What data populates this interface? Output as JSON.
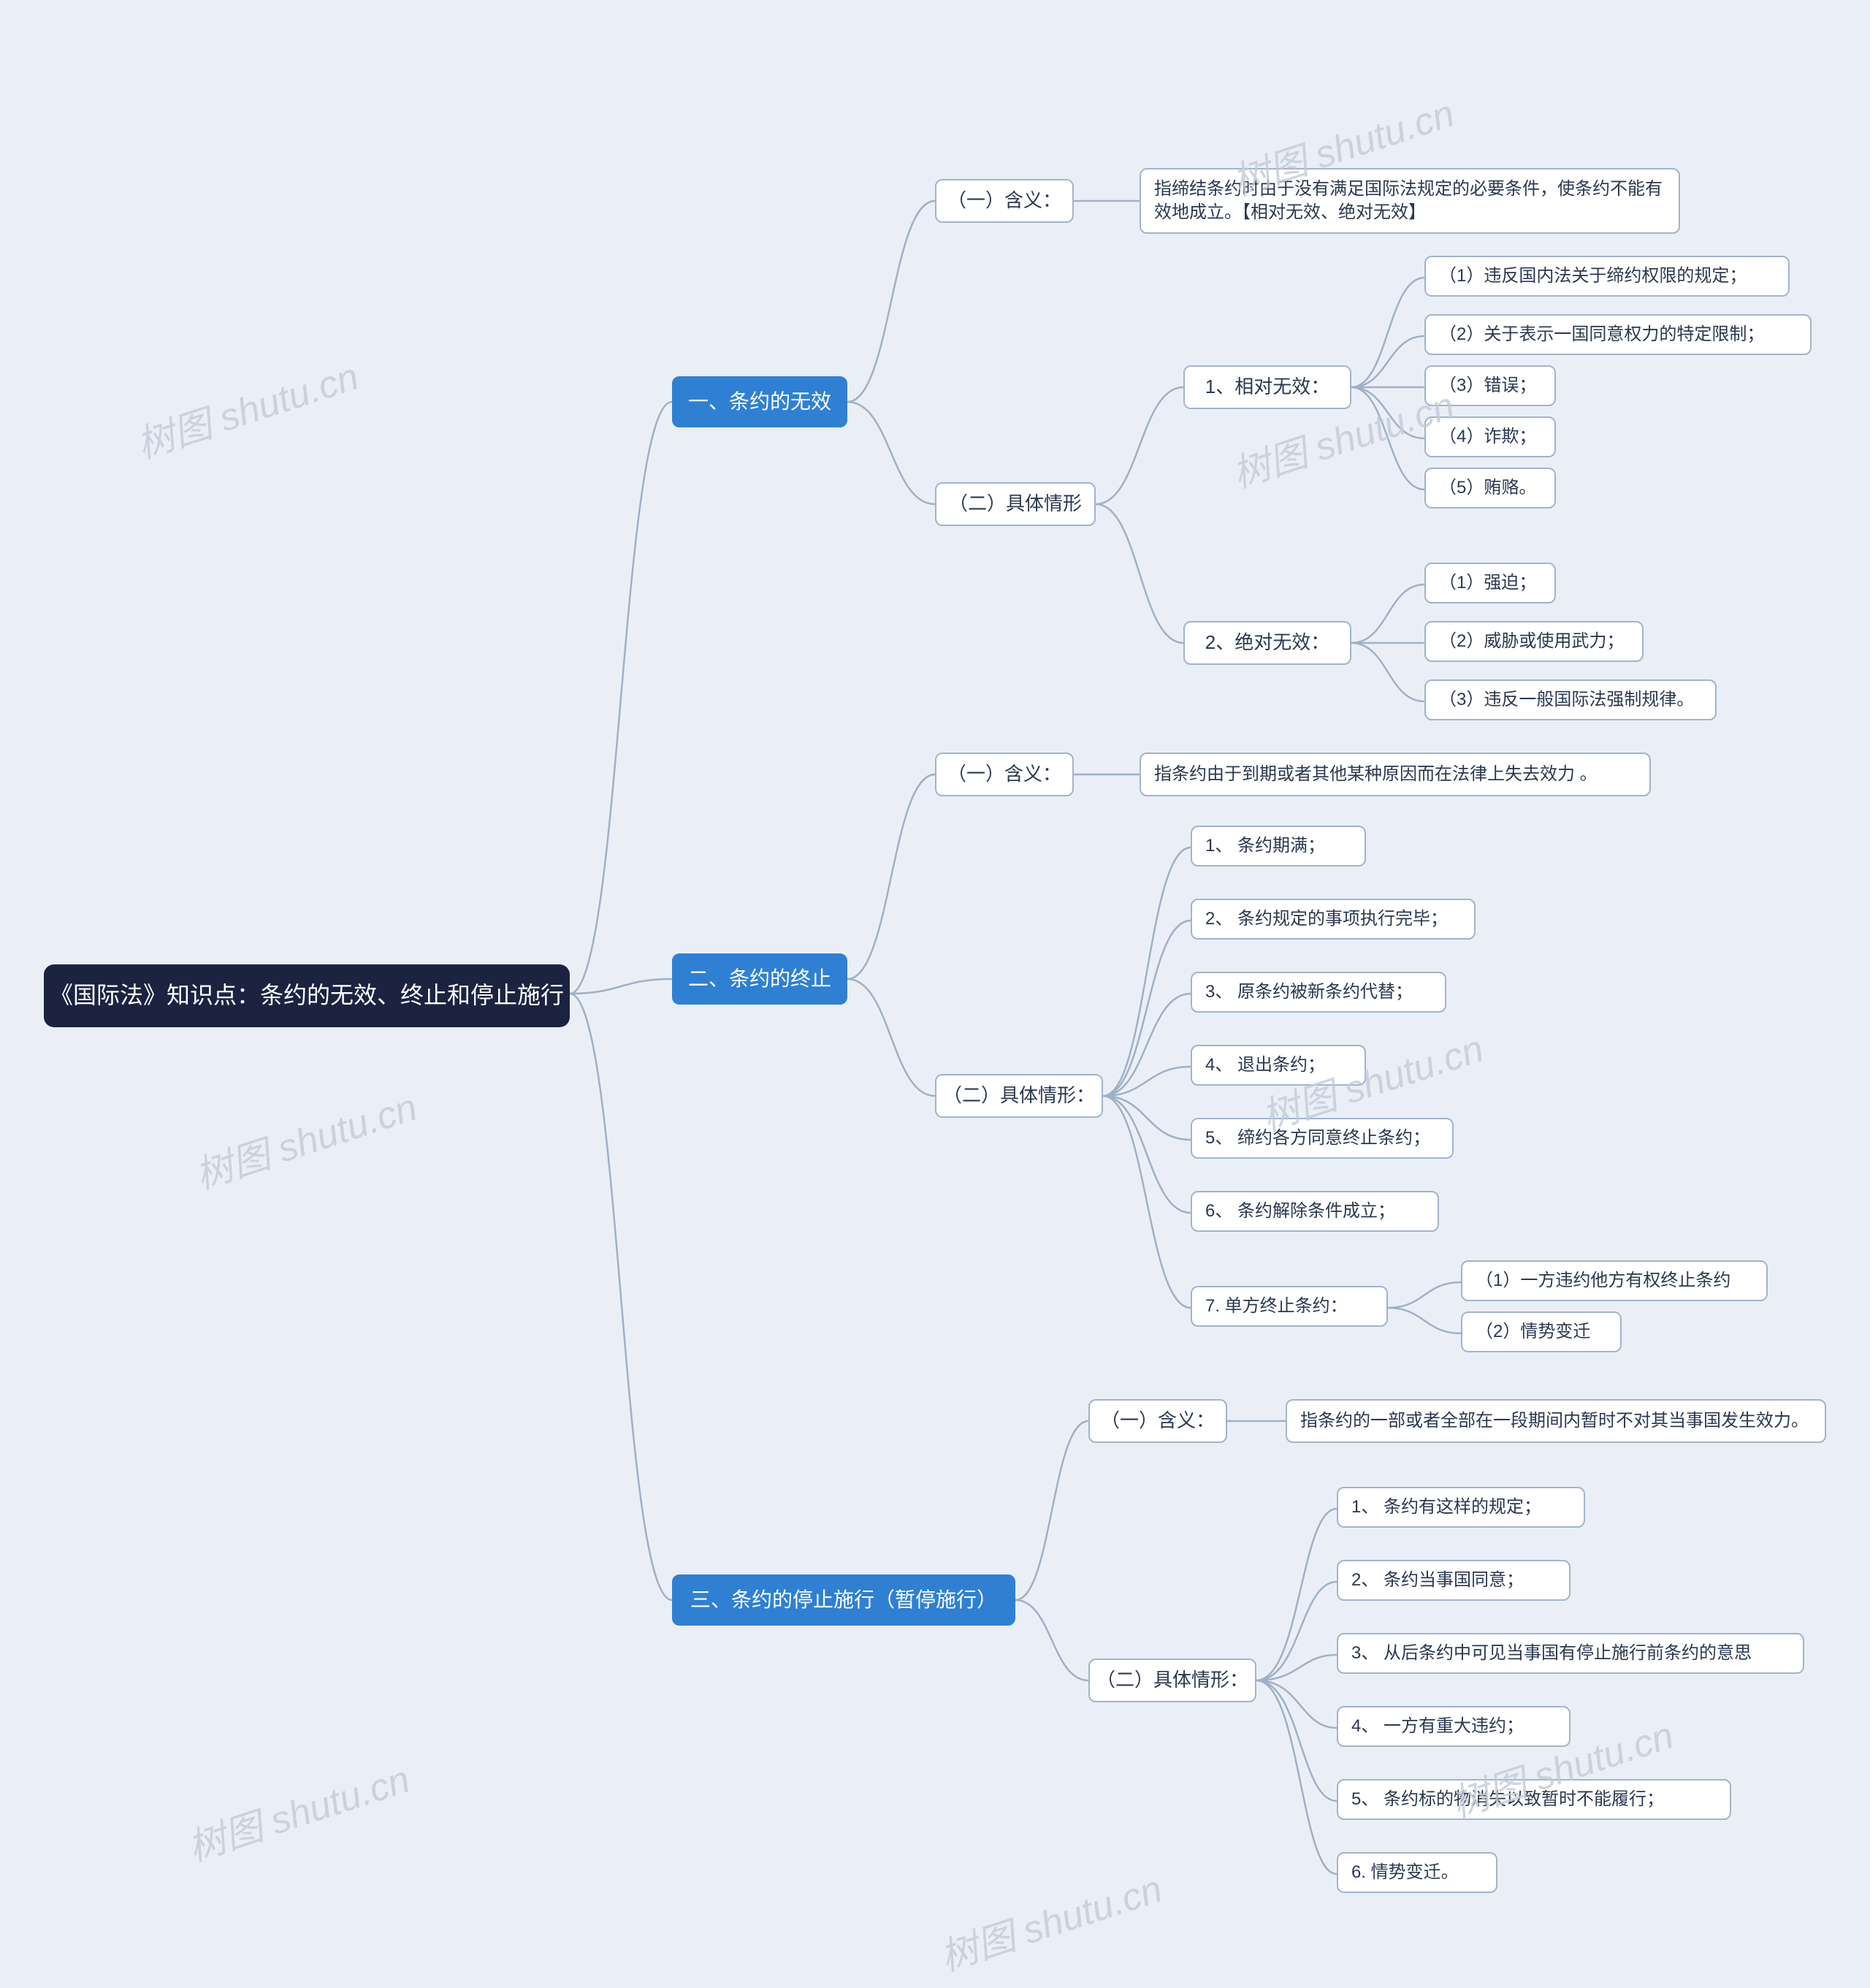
{
  "colors": {
    "bg": "#eaeff7",
    "root": "#1b2340",
    "lvl1": "#2f80d3",
    "border": "#a2b3cc",
    "link": "#9fb0c6"
  },
  "watermark": "树图 shutu.cn",
  "root": {
    "label": "《国际法》知识点：条约的无效、终止和停止施行"
  },
  "branches": {
    "b1": {
      "label": "一、条约的无效"
    },
    "b2": {
      "label": "二、条约的终止"
    },
    "b3": {
      "label": "三、条约的停止施行（暂停施行）"
    }
  },
  "nodes": {
    "b1_m": "（一）含义：",
    "b1_m_t": "指缔结条约时由于没有满足国际法规定的必要条件，使条约不能有效地成立。【相对无效、绝对无效】",
    "b1_2": "（二）具体情形",
    "b1_2a": "1、相对无效：",
    "b1_2a_1": "（1）违反国内法关于缔约权限的规定；",
    "b1_2a_2": "（2）关于表示一国同意权力的特定限制；",
    "b1_2a_3": "（3）错误；",
    "b1_2a_4": "（4）诈欺；",
    "b1_2a_5": "（5）贿赂。",
    "b1_2b": "2、绝对无效：",
    "b1_2b_1": "（1）强迫；",
    "b1_2b_2": "（2）威胁或使用武力；",
    "b1_2b_3": "（3）违反一般国际法强制规律。",
    "b2_m": "（一）含义：",
    "b2_m_t": "指条约由于到期或者其他某种原因而在法律上失去效力 。",
    "b2_2": "（二）具体情形：",
    "b2_2_1": "1、 条约期满；",
    "b2_2_2": "2、 条约规定的事项执行完毕；",
    "b2_2_3": "3、 原条约被新条约代替；",
    "b2_2_4": "4、 退出条约；",
    "b2_2_5": "5、 缔约各方同意终止条约；",
    "b2_2_6": "6、 条约解除条件成立；",
    "b2_2_7": "7. 单方终止条约：",
    "b2_2_7_1": "（1）一方违约他方有权终止条约",
    "b2_2_7_2": "（2）情势变迁",
    "b3_m": "（一）含义：",
    "b3_m_t": "指条约的一部或者全部在一段期间内暂时不对其当事国发生效力。",
    "b3_2": "（二）具体情形：",
    "b3_2_1": "1、 条约有这样的规定；",
    "b3_2_2": "2、 条约当事国同意；",
    "b3_2_3": "3、 从后条约中可见当事国有停止施行前条约的意思",
    "b3_2_4": "4、 一方有重大违约；",
    "b3_2_5": "5、 条约标的物消失以致暂时不能履行；",
    "b3_2_6": "6. 情势变迁。"
  }
}
